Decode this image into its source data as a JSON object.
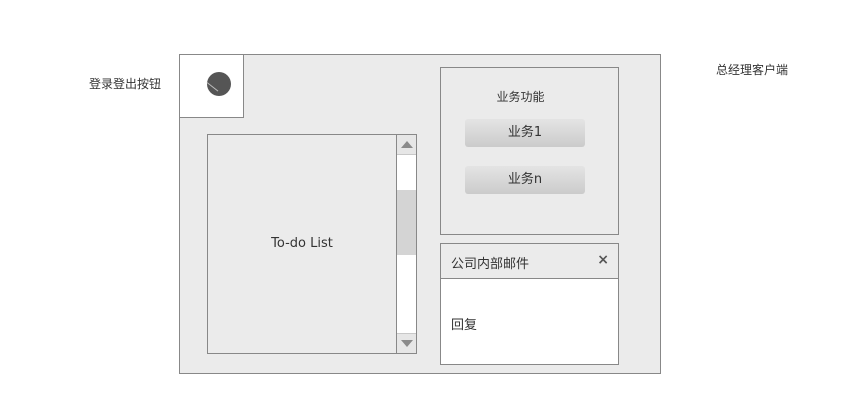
{
  "annotations": {
    "login_button_label": "登录登出按钮",
    "client_label": "总经理客户端"
  },
  "todo": {
    "label": "To-do List"
  },
  "business": {
    "title": "业务功能",
    "buttons": [
      "业务1",
      "业务n"
    ]
  },
  "mail": {
    "title": "公司内部邮件",
    "close": "×",
    "body": "回复"
  },
  "colors": {
    "frame_bg": "#ebebeb",
    "border": "#888888",
    "dot": "#555555"
  }
}
